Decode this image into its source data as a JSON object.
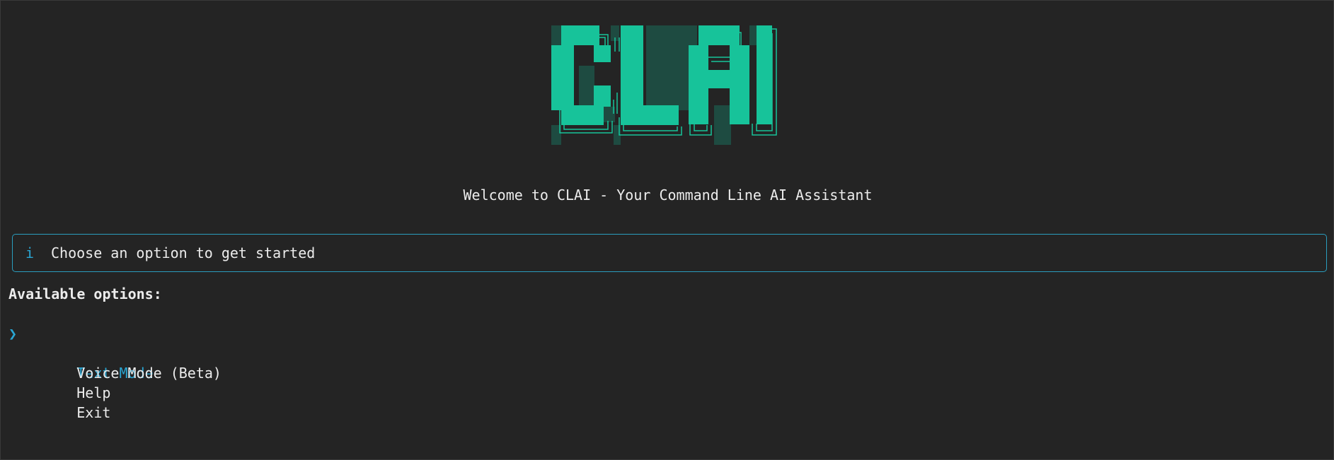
{
  "logo": {
    "text": "CLAI",
    "colors": {
      "primary": "#17c39a",
      "shadow": "#1e4b41",
      "outline": "#17c39a"
    }
  },
  "welcome_text": "Welcome to CLAI - Your Command Line AI Assistant",
  "info": {
    "icon": "info-icon",
    "glyph": "i",
    "text": "Choose an option to get started",
    "border_color": "#2a9ebf"
  },
  "options_title": "Available options:",
  "menu": {
    "pointer_glyph": "❯",
    "selected_index": 0,
    "items": [
      {
        "label": "Text Mode"
      },
      {
        "label": "Voice Mode (Beta)"
      },
      {
        "label": "Help"
      },
      {
        "label": "Exit"
      }
    ]
  },
  "colors": {
    "background": "#242424",
    "foreground": "#ececec",
    "accent": "#2aa6d3"
  }
}
